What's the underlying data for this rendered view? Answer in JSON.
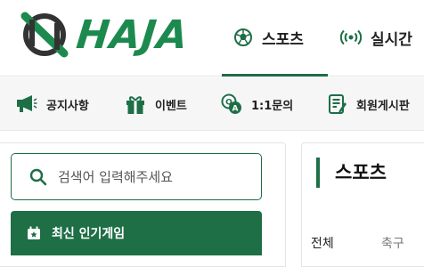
{
  "header": {
    "logo_text": "HAJA",
    "nav": [
      {
        "label": "스포츠",
        "icon": "soccer-ball-icon",
        "active": true
      },
      {
        "label": "실시간",
        "icon": "broadcast-icon",
        "active": false
      }
    ]
  },
  "subnav": {
    "items": [
      {
        "label": "공지사항",
        "icon": "megaphone-icon"
      },
      {
        "label": "이벤트",
        "icon": "gift-icon"
      },
      {
        "label": "1:1문의",
        "icon": "qa-chat-icon"
      },
      {
        "label": "회원게시판",
        "icon": "board-icon"
      }
    ]
  },
  "sidebar": {
    "search_placeholder": "검색어 입력해주세요",
    "popular_label": "최신 인기게임"
  },
  "main": {
    "section_title": "스포츠",
    "tabs": [
      {
        "label": "전체",
        "active": true
      },
      {
        "label": "축구",
        "active": false
      }
    ]
  },
  "colors": {
    "brand_green": "#1e6e46",
    "logo_green": "#1c8a4e",
    "logo_dark": "#333333"
  }
}
